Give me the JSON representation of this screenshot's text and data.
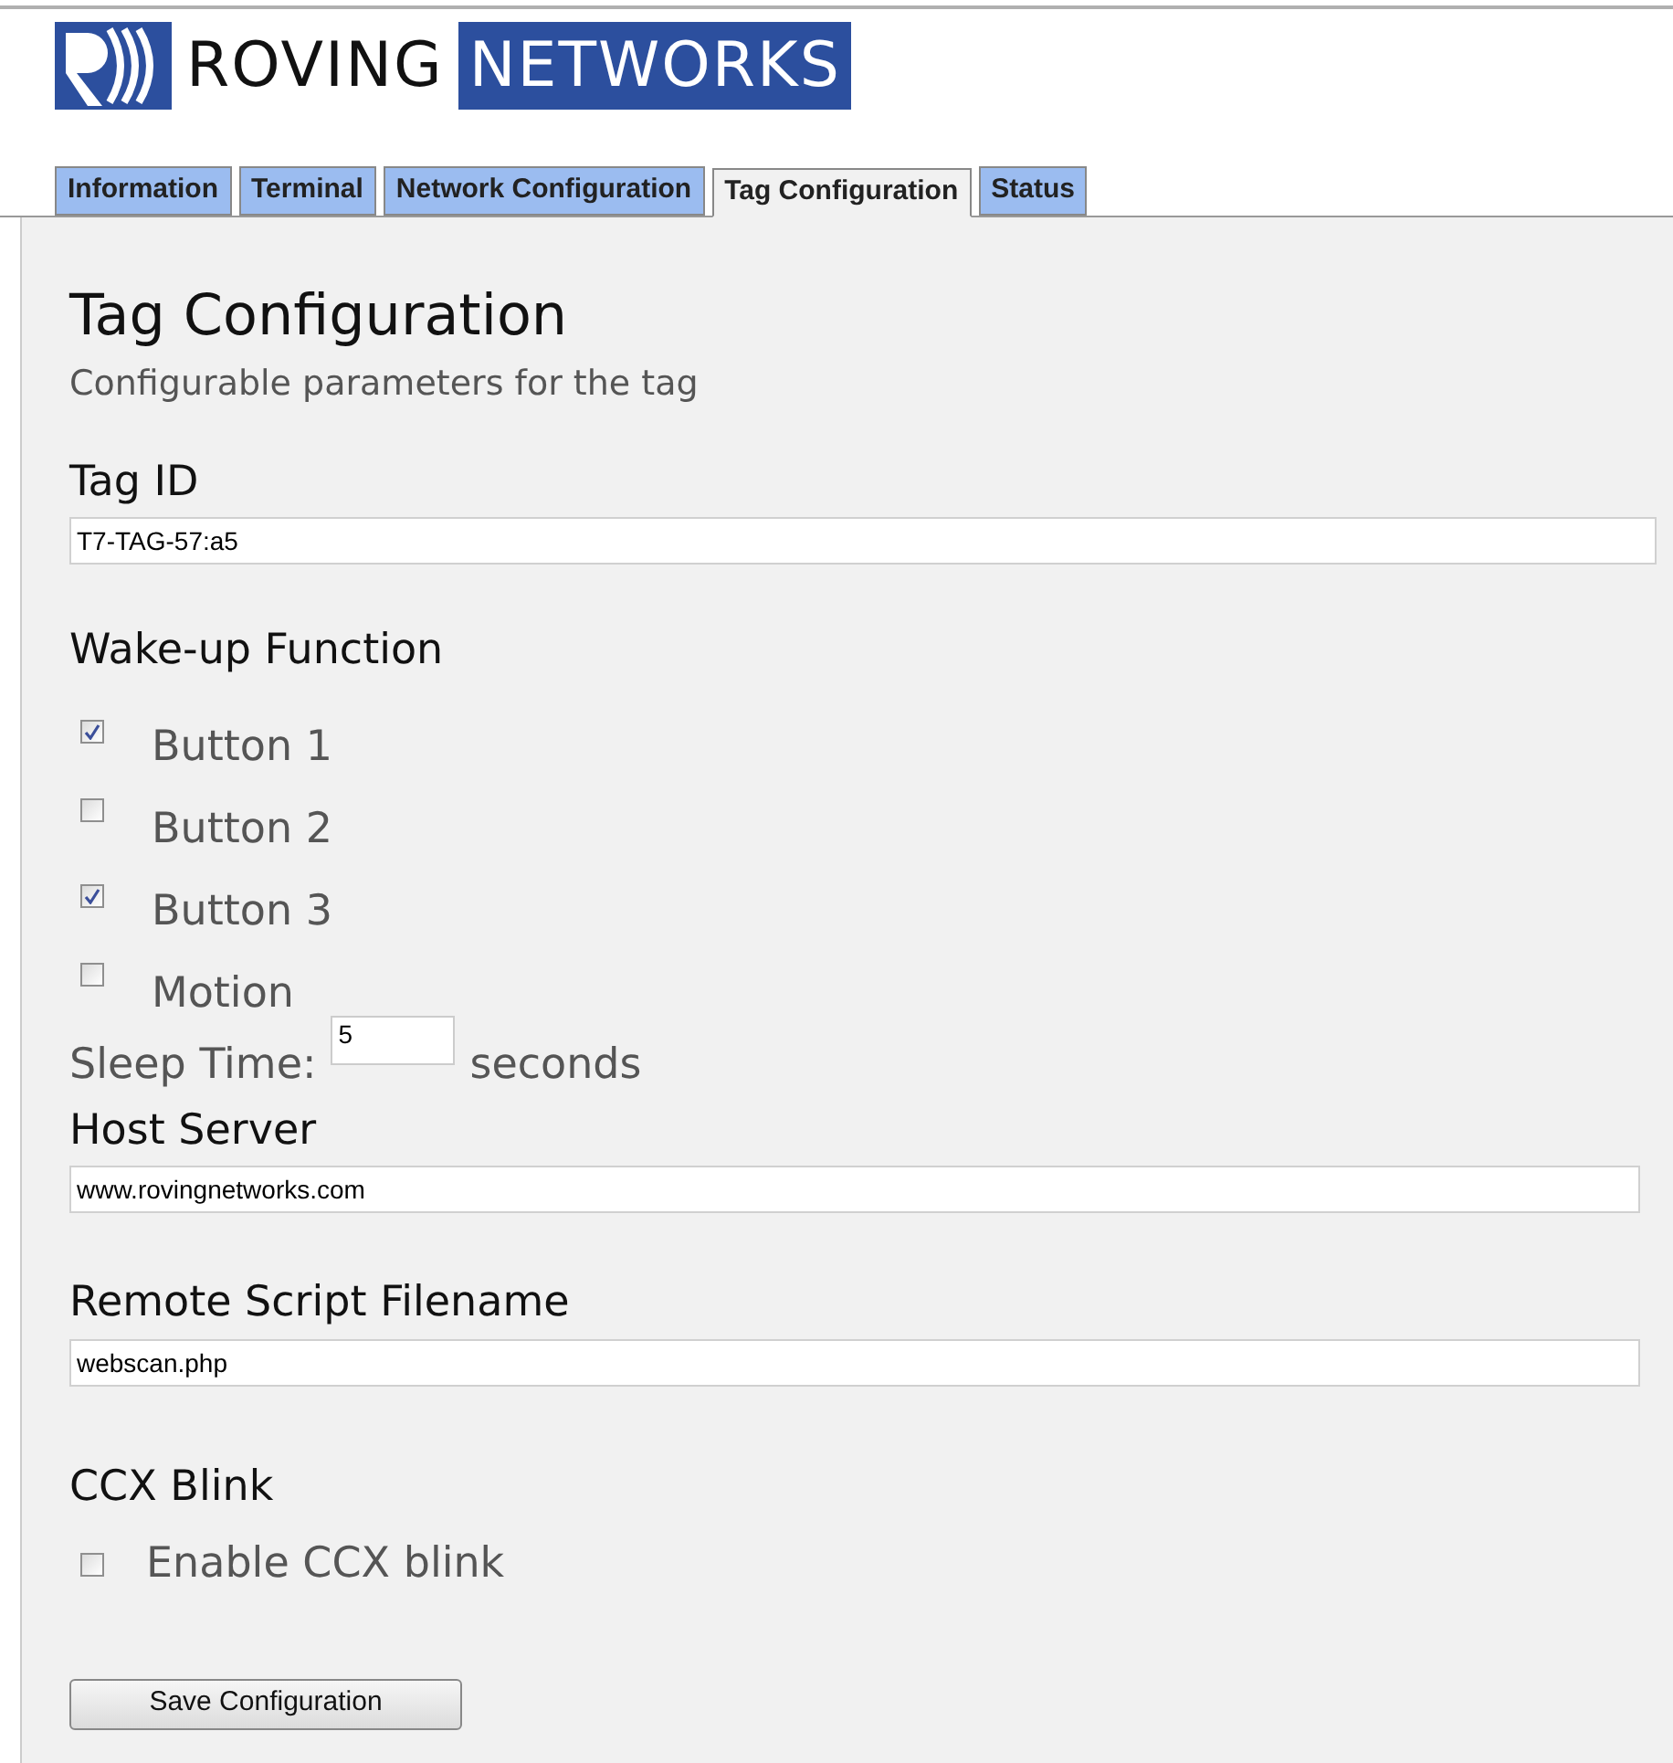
{
  "logo": {
    "word_1": "ROVING",
    "word_2": "NETWORKS"
  },
  "tabs": [
    {
      "label": "Information",
      "selected": false
    },
    {
      "label": "Terminal",
      "selected": false
    },
    {
      "label": "Network Configuration",
      "selected": false
    },
    {
      "label": "Tag Configuration",
      "selected": true
    },
    {
      "label": "Status",
      "selected": false
    }
  ],
  "title": "Tag Configuration",
  "subtitle": "Configurable parameters for the tag",
  "tag_id": {
    "heading": "Tag ID",
    "value": "T7-TAG-57:a5"
  },
  "wakeup": {
    "heading": "Wake-up Function",
    "options": [
      {
        "label": "Button 1",
        "checked": true
      },
      {
        "label": "Button 2",
        "checked": false
      },
      {
        "label": "Button 3",
        "checked": true
      },
      {
        "label": "Motion",
        "checked": false
      }
    ]
  },
  "sleep_time": {
    "label": "Sleep Time:",
    "value": "5",
    "unit": "seconds"
  },
  "host_server": {
    "heading": "Host Server",
    "value": "www.rovingnetworks.com"
  },
  "remote_script": {
    "heading": "Remote Script Filename",
    "value": "webscan.php"
  },
  "ccx": {
    "heading": "CCX Blink",
    "label": "Enable CCX blink",
    "checked": false
  },
  "save_button": "Save Configuration"
}
